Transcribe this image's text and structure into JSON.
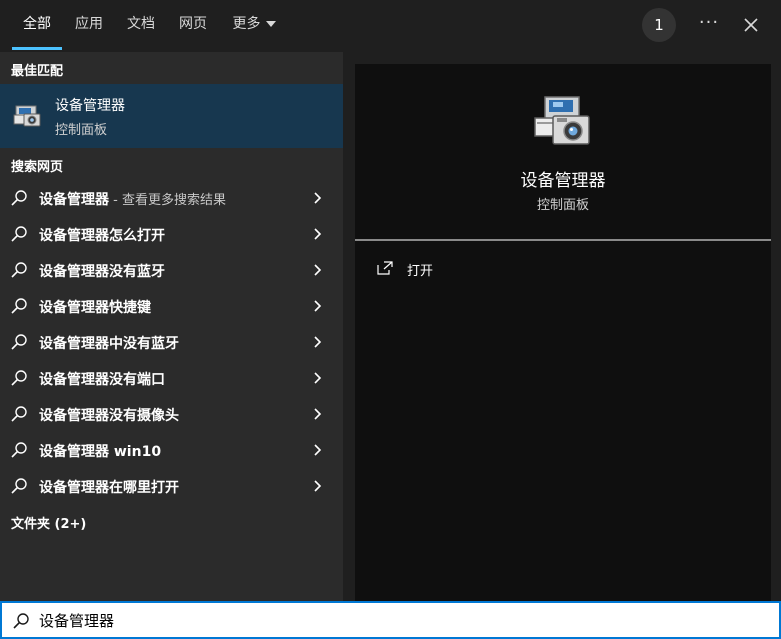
{
  "tabs": [
    {
      "label": "全部",
      "active": true
    },
    {
      "label": "应用"
    },
    {
      "label": "文档"
    },
    {
      "label": "网页"
    },
    {
      "label": "更多"
    }
  ],
  "header": {
    "badge": "1",
    "more_options": "···"
  },
  "left": {
    "best_match_title": "最佳匹配",
    "best_match": {
      "name": "设备管理器",
      "subtitle": "控制面板",
      "icon": "device-manager-icon"
    },
    "web_title": "搜索网页",
    "web_results": [
      {
        "text": "设备管理器",
        "extra": " - 查看更多搜索结果"
      },
      {
        "text": "设备管理器怎么打开",
        "extra": ""
      },
      {
        "text": "设备管理器没有蓝牙",
        "extra": ""
      },
      {
        "text": "设备管理器快捷键",
        "extra": ""
      },
      {
        "text": "设备管理器中没有蓝牙",
        "extra": ""
      },
      {
        "text": "设备管理器没有端口",
        "extra": ""
      },
      {
        "text": "设备管理器没有摄像头",
        "extra": ""
      },
      {
        "text": "设备管理器 win10",
        "extra": ""
      },
      {
        "text": "设备管理器在哪里打开",
        "extra": ""
      }
    ],
    "folders_title": "文件夹 (2+)"
  },
  "preview": {
    "title": "设备管理器",
    "subtitle": "控制面板",
    "actions": [
      {
        "label": "打开",
        "icon": "open-icon"
      }
    ]
  },
  "search": {
    "value": "设备管理器",
    "icon": "search-icon"
  },
  "colors": {
    "accent": "#4cc2ff",
    "selected_bg": "#17374f",
    "search_border": "#0078d4"
  }
}
